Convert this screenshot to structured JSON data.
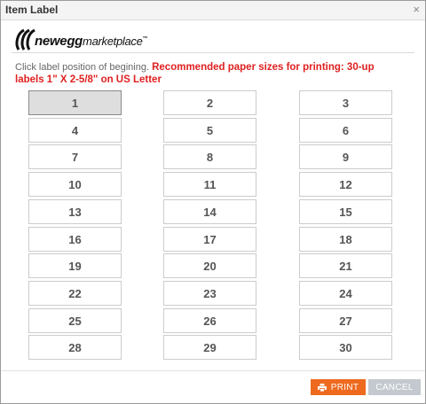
{
  "dialog": {
    "title": "Item Label",
    "close_glyph": "×"
  },
  "logo": {
    "brand": "newegg",
    "product": "marketplace",
    "trademark": "™"
  },
  "instructions": {
    "text": "Click label position of begining.",
    "recommendation": "Recommended paper sizes for printing: 30-up labels 1\" X 2-5/8\" on US Letter"
  },
  "grid": {
    "selected": "1",
    "labels": [
      "1",
      "2",
      "3",
      "4",
      "5",
      "6",
      "7",
      "8",
      "9",
      "10",
      "11",
      "12",
      "13",
      "14",
      "15",
      "16",
      "17",
      "18",
      "19",
      "20",
      "21",
      "22",
      "23",
      "24",
      "25",
      "26",
      "27",
      "28",
      "29",
      "30"
    ]
  },
  "buttons": {
    "print": "PRINT",
    "cancel": "CANCEL"
  },
  "colors": {
    "print_button": "#ee6a1e",
    "cancel_button": "#c3c9cf",
    "recommendation_text": "#e02020"
  },
  "icons": {
    "print": "printer-icon",
    "close": "close-icon"
  }
}
